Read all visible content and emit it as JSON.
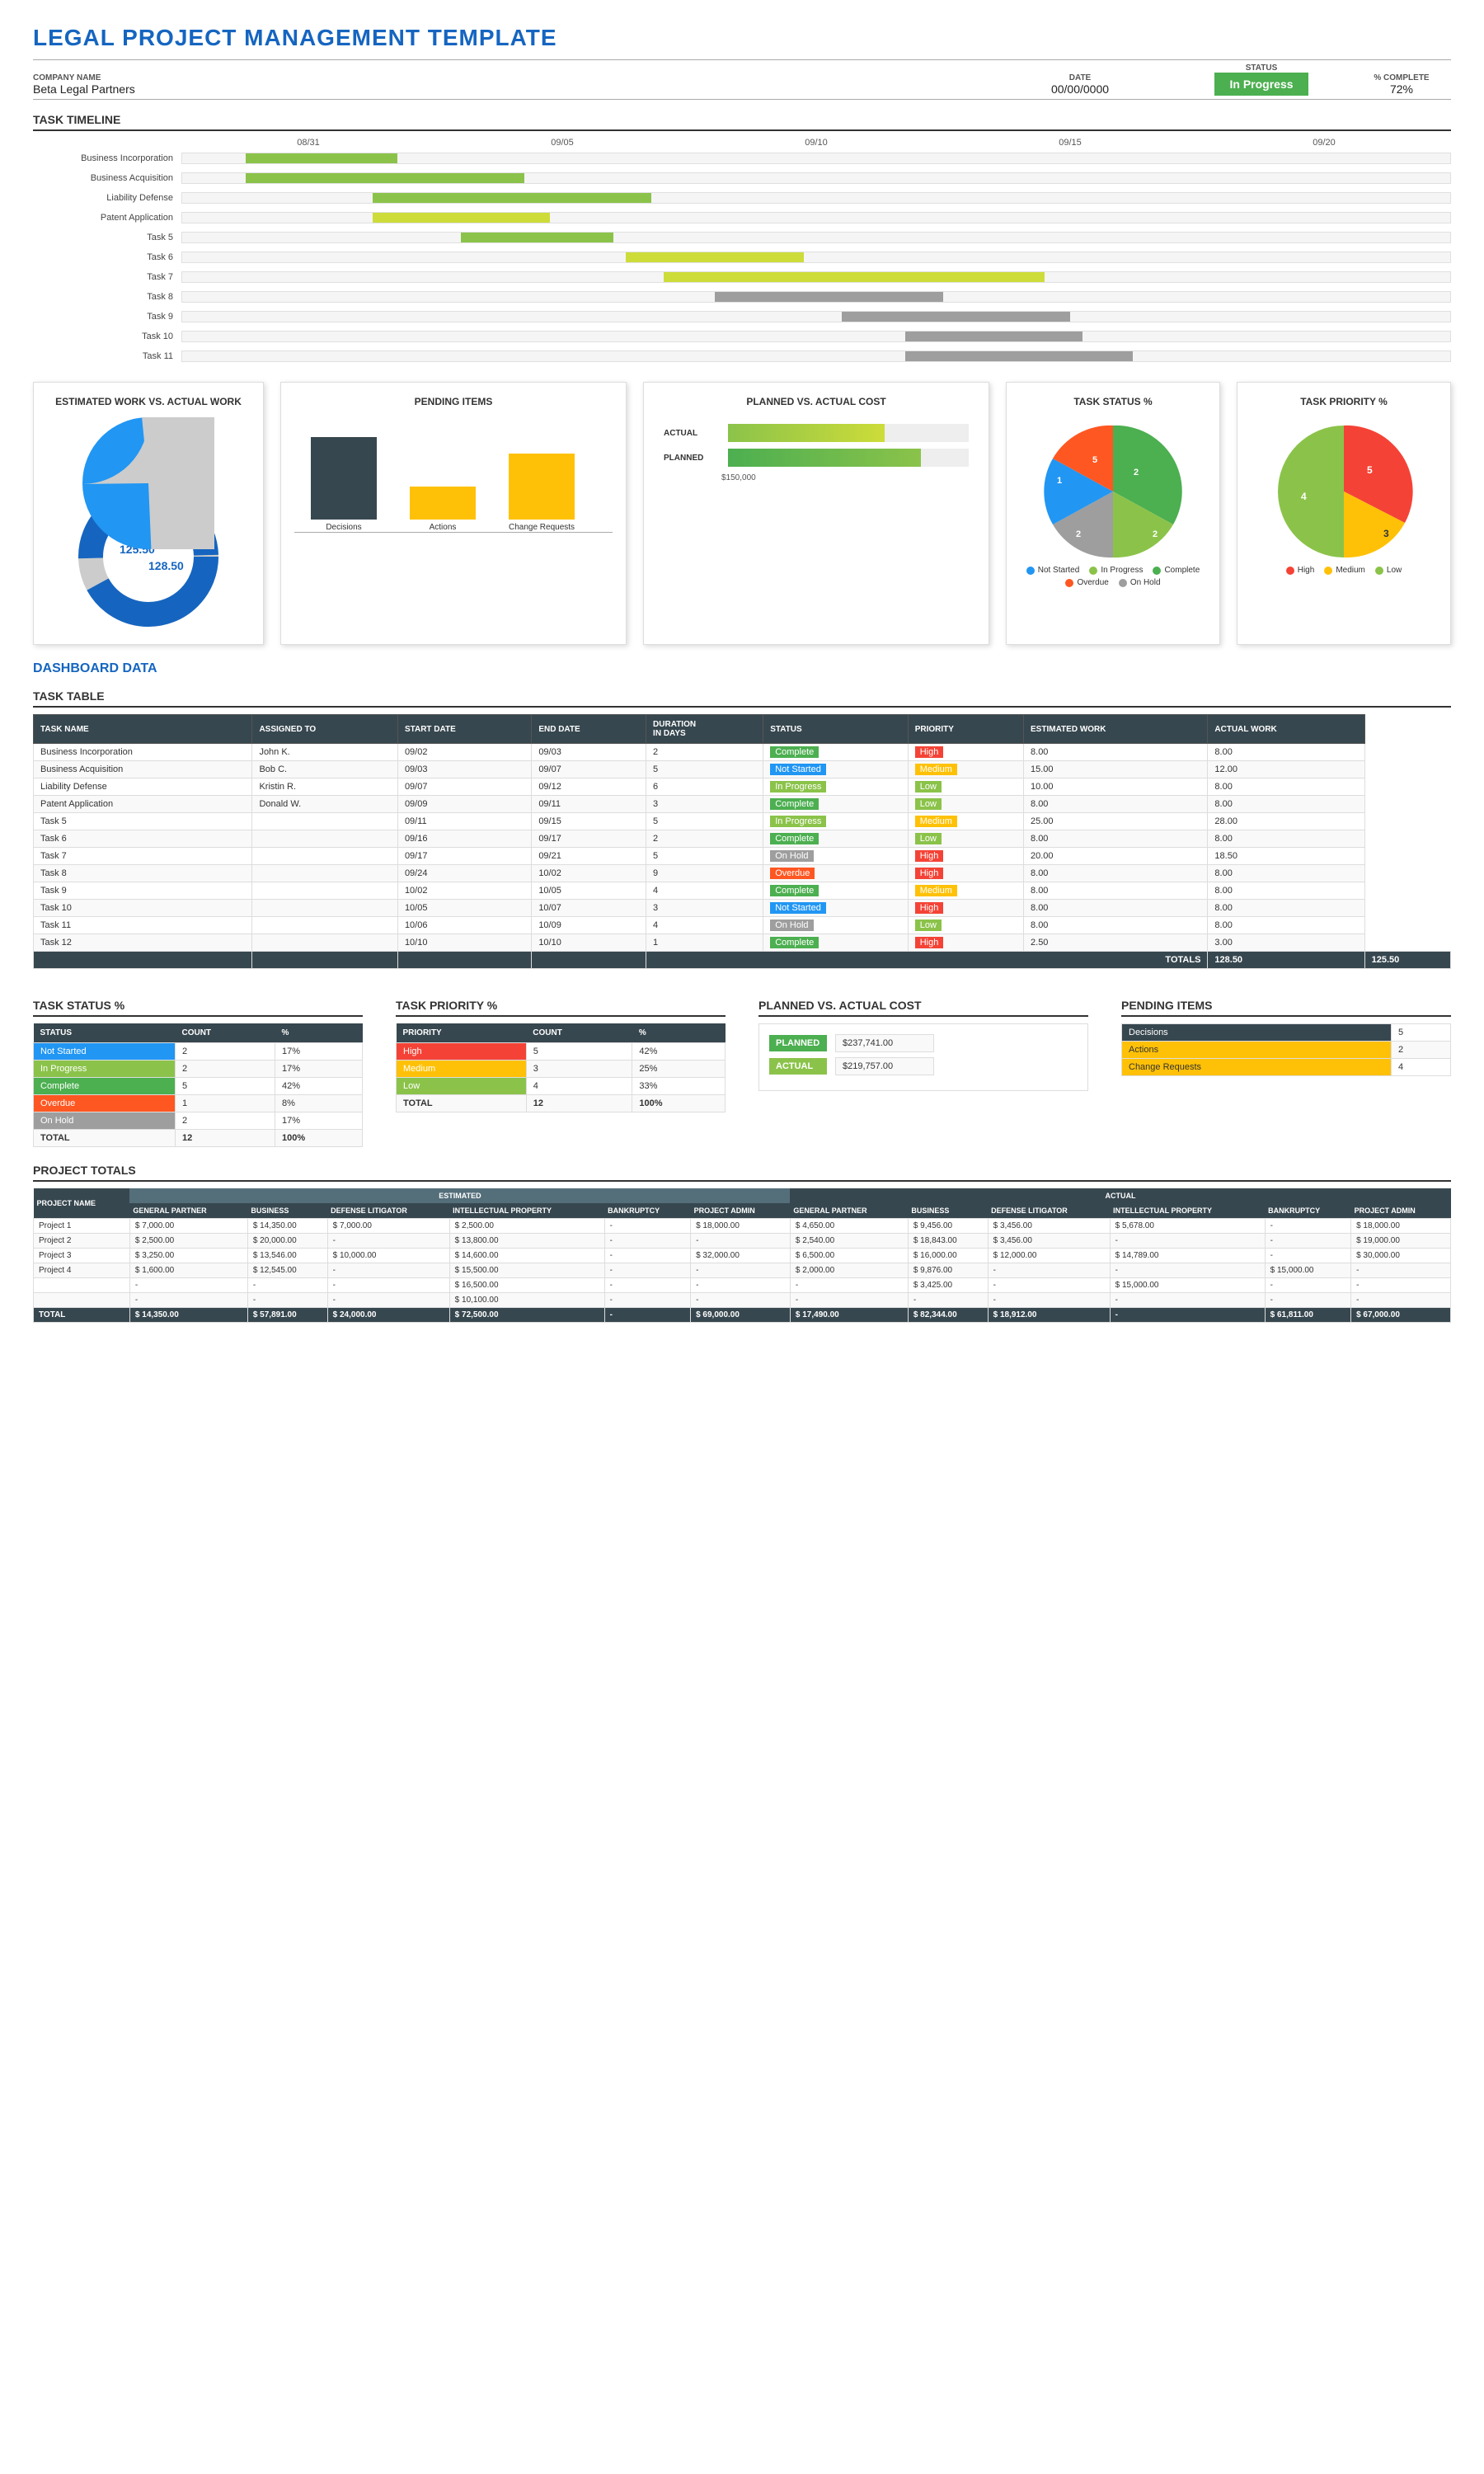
{
  "title": "LEGAL PROJECT MANAGEMENT TEMPLATE",
  "header": {
    "company_label": "COMPANY NAME",
    "company_value": "Beta Legal Partners",
    "date_label": "DATE",
    "date_value": "00/00/0000",
    "status_label": "STATUS",
    "status_value": "In Progress",
    "complete_label": "% COMPLETE",
    "complete_value": "72%"
  },
  "gantt": {
    "title": "TASK TIMELINE",
    "date_labels": [
      "08/31",
      "09/05",
      "09/10",
      "09/15",
      "09/20"
    ],
    "tasks": [
      {
        "name": "Business Incorporation",
        "start": 5,
        "width": 12,
        "color": "green"
      },
      {
        "name": "Business Acquisition",
        "start": 5,
        "width": 22,
        "color": "green"
      },
      {
        "name": "Liability Defense",
        "start": 15,
        "width": 22,
        "color": "green"
      },
      {
        "name": "Patent Application",
        "start": 15,
        "width": 14,
        "color": "lightgreen"
      },
      {
        "name": "Task 5",
        "start": 22,
        "width": 12,
        "color": "green"
      },
      {
        "name": "Task 6",
        "start": 35,
        "width": 14,
        "color": "lightgreen"
      },
      {
        "name": "Task 7",
        "start": 38,
        "width": 30,
        "color": "lightgreen"
      },
      {
        "name": "Task 8",
        "start": 42,
        "width": 18,
        "color": "gray"
      },
      {
        "name": "Task 9",
        "start": 52,
        "width": 18,
        "color": "gray"
      },
      {
        "name": "Task 10",
        "start": 57,
        "width": 14,
        "color": "gray"
      },
      {
        "name": "Task 11",
        "start": 57,
        "width": 18,
        "color": "gray"
      }
    ]
  },
  "estimated_vs_actual": {
    "title": "ESTIMATED WORK VS. ACTUAL WORK",
    "estimated_value": "125.50",
    "actual_value": "128.50"
  },
  "pending_items_chart": {
    "title": "PENDING ITEMS",
    "items": [
      {
        "label": "Decisions",
        "value": 5,
        "color": "#37474F",
        "height": 100
      },
      {
        "label": "Actions",
        "value": 2,
        "color": "#FFC107",
        "height": 40
      },
      {
        "label": "Change Requests",
        "value": 4,
        "color": "#FFC107",
        "height": 80
      }
    ]
  },
  "planned_vs_actual_cost_chart": {
    "title": "PLANNED VS. ACTUAL COST",
    "planned_label": "PLANNED",
    "planned_value": "$237,741.00",
    "planned_width": 80,
    "actual_label": "ACTUAL",
    "actual_value": "$219,757.00",
    "actual_width": 65,
    "axis_label": "$150,000"
  },
  "task_status_pie": {
    "title": "TASK STATUS %",
    "segments": [
      {
        "label": "Not Started",
        "color": "#2196F3",
        "value": 2,
        "pct": 17
      },
      {
        "label": "In Progress",
        "color": "#8BC34A",
        "value": 2,
        "pct": 17
      },
      {
        "label": "Complete",
        "color": "#4CAF50",
        "value": 5,
        "pct": 42
      },
      {
        "label": "Overdue",
        "color": "#FF5722",
        "value": 1,
        "pct": 8
      },
      {
        "label": "On Hold",
        "color": "#9E9E9E",
        "value": 2,
        "pct": 17
      }
    ],
    "labels_on_chart": [
      "1",
      "2",
      "2",
      "2",
      "5"
    ]
  },
  "task_priority_pie": {
    "title": "TASK PRIORITY %",
    "segments": [
      {
        "label": "High",
        "color": "#F44336",
        "value": 5,
        "pct": 42
      },
      {
        "label": "Medium",
        "color": "#FFC107",
        "value": 3,
        "pct": 25
      },
      {
        "label": "Low",
        "color": "#8BC34A",
        "value": 4,
        "pct": 33
      }
    ],
    "labels_on_chart": [
      "3",
      "4",
      "5"
    ]
  },
  "task_table": {
    "title": "TASK TABLE",
    "columns": [
      "TASK NAME",
      "ASSIGNED TO",
      "START DATE",
      "END DATE",
      "DURATION (in days)",
      "STATUS",
      "PRIORITY",
      "ESTIMATED WORK",
      "ACTUAL WORK"
    ],
    "rows": [
      {
        "name": "Business Incorporation",
        "assigned": "John K.",
        "start": "09/02",
        "end": "09/03",
        "duration": 2,
        "status": "Complete",
        "priority": "High",
        "est_work": 8.0,
        "act_work": 8.0
      },
      {
        "name": "Business Acquisition",
        "assigned": "Bob C.",
        "start": "09/03",
        "end": "09/07",
        "duration": 5,
        "status": "Not Started",
        "priority": "Medium",
        "est_work": 15.0,
        "act_work": 12.0
      },
      {
        "name": "Liability Defense",
        "assigned": "Kristin R.",
        "start": "09/07",
        "end": "09/12",
        "duration": 6,
        "status": "In Progress",
        "priority": "Low",
        "est_work": 10.0,
        "act_work": 8.0
      },
      {
        "name": "Patent Application",
        "assigned": "Donald W.",
        "start": "09/09",
        "end": "09/11",
        "duration": 3,
        "status": "Complete",
        "priority": "Low",
        "est_work": 8.0,
        "act_work": 8.0
      },
      {
        "name": "Task 5",
        "assigned": "",
        "start": "09/11",
        "end": "09/15",
        "duration": 5,
        "status": "In Progress",
        "priority": "Medium",
        "est_work": 25.0,
        "act_work": 28.0
      },
      {
        "name": "Task 6",
        "assigned": "",
        "start": "09/16",
        "end": "09/17",
        "duration": 2,
        "status": "Complete",
        "priority": "Low",
        "est_work": 8.0,
        "act_work": 8.0
      },
      {
        "name": "Task 7",
        "assigned": "",
        "start": "09/17",
        "end": "09/21",
        "duration": 5,
        "status": "On Hold",
        "priority": "High",
        "est_work": 20.0,
        "act_work": 18.5
      },
      {
        "name": "Task 8",
        "assigned": "",
        "start": "09/24",
        "end": "10/02",
        "duration": 9,
        "status": "Overdue",
        "priority": "High",
        "est_work": 8.0,
        "act_work": 8.0
      },
      {
        "name": "Task 9",
        "assigned": "",
        "start": "10/02",
        "end": "10/05",
        "duration": 4,
        "status": "Complete",
        "priority": "Medium",
        "est_work": 8.0,
        "act_work": 8.0
      },
      {
        "name": "Task 10",
        "assigned": "",
        "start": "10/05",
        "end": "10/07",
        "duration": 3,
        "status": "Not Started",
        "priority": "High",
        "est_work": 8.0,
        "act_work": 8.0
      },
      {
        "name": "Task 11",
        "assigned": "",
        "start": "10/06",
        "end": "10/09",
        "duration": 4,
        "status": "On Hold",
        "priority": "Low",
        "est_work": 8.0,
        "act_work": 8.0
      },
      {
        "name": "Task 12",
        "assigned": "",
        "start": "10/10",
        "end": "10/10",
        "duration": 1,
        "status": "Complete",
        "priority": "High",
        "est_work": 2.5,
        "act_work": 3.0
      }
    ],
    "totals_label": "TOTALS",
    "totals_est": "128.50",
    "totals_act": "125.50"
  },
  "task_status_table": {
    "title": "TASK STATUS %",
    "columns": [
      "STATUS",
      "COUNT",
      "%"
    ],
    "rows": [
      {
        "status": "Not Started",
        "count": 2,
        "pct": "17%",
        "color_class": "stats-status-ns"
      },
      {
        "status": "In Progress",
        "count": 2,
        "pct": "17%",
        "color_class": "stats-status-ip"
      },
      {
        "status": "Complete",
        "count": 5,
        "pct": "42%",
        "color_class": "stats-status-co"
      },
      {
        "status": "Overdue",
        "count": 1,
        "pct": "8%",
        "color_class": "stats-status-ov"
      },
      {
        "status": "On Hold",
        "count": 2,
        "pct": "17%",
        "color_class": "stats-status-oh"
      }
    ],
    "total_label": "TOTAL",
    "total_count": 12,
    "total_pct": "100%"
  },
  "task_priority_table": {
    "title": "TASK PRIORITY %",
    "columns": [
      "PRIORITY",
      "COUNT",
      "%"
    ],
    "rows": [
      {
        "priority": "High",
        "count": 5,
        "pct": "42%",
        "color_class": "stats-priority-high"
      },
      {
        "priority": "Medium",
        "count": 3,
        "pct": "25%",
        "color_class": "stats-priority-med"
      },
      {
        "priority": "Low",
        "count": 4,
        "pct": "33%",
        "color_class": "stats-priority-low"
      }
    ],
    "total_label": "TOTAL",
    "total_count": 12,
    "total_pct": "100%"
  },
  "planned_actual_cost": {
    "title": "PLANNED VS. ACTUAL COST",
    "planned_label": "PLANNED",
    "planned_value": "$237,741.00",
    "actual_label": "ACTUAL",
    "actual_value": "$219,757.00"
  },
  "pending_items_table": {
    "title": "PENDING ITEMS",
    "columns": [
      "",
      ""
    ],
    "rows": [
      {
        "label": "Decisions",
        "value": 5,
        "color_class": "decisions"
      },
      {
        "label": "Actions",
        "value": 2,
        "color_class": "actions"
      },
      {
        "label": "Change Requests",
        "value": 4,
        "color_class": "change-req"
      }
    ]
  },
  "project_totals": {
    "title": "PROJECT TOTALS",
    "estimated_header": "ESTIMATED",
    "actual_header": "ACTUAL",
    "columns_estimated": [
      "GENERAL PARTNER",
      "BUSINESS",
      "DEFENSE LITIGATOR",
      "INTELLECTUAL PROPERTY",
      "BANKRUPTCY",
      "PROJECT ADMIN"
    ],
    "columns_actual": [
      "GENERAL PARTNER",
      "BUSINESS",
      "DEFENSE LITIGATOR",
      "INTELLECTUAL PROPERTY",
      "BANKRUPTCY",
      "PROJECT ADMIN"
    ],
    "rows": [
      {
        "name": "Project 1",
        "est": [
          "7,000.00",
          "14,350.00",
          "7,000.00",
          "2,500.00",
          "-",
          "18,000.00"
        ],
        "act": [
          "4,650.00",
          "9,456.00",
          "3,456.00",
          "5,678.00",
          "-",
          "18,000.00"
        ]
      },
      {
        "name": "Project 2",
        "est": [
          "2,500.00",
          "20,000.00",
          "-",
          "13,800.00",
          "-",
          "-"
        ],
        "act": [
          "2,540.00",
          "18,843.00",
          "3,456.00",
          "-",
          "-",
          "19,000.00"
        ]
      },
      {
        "name": "Project 3",
        "est": [
          "3,250.00",
          "13,546.00",
          "10,000.00",
          "14,600.00",
          "-",
          "32,000.00"
        ],
        "act": [
          "6,500.00",
          "16,000.00",
          "12,000.00",
          "14,789.00",
          "-",
          "30,000.00"
        ]
      },
      {
        "name": "Project 4",
        "est": [
          "1,600.00",
          "12,545.00",
          "-",
          "15,500.00",
          "-",
          "-"
        ],
        "act": [
          "2,000.00",
          "9,876.00",
          "-",
          "-",
          "15,000.00",
          "-"
        ]
      },
      {
        "name": "",
        "est": [
          "-",
          "-",
          "-",
          "16,500.00",
          "-",
          "-"
        ],
        "act": [
          "-",
          "3,425.00",
          "-",
          "15,000.00",
          "-",
          "-"
        ]
      },
      {
        "name": "",
        "est": [
          "-",
          "-",
          "-",
          "10,100.00",
          "-",
          "-"
        ],
        "act": [
          "-",
          "-",
          "-",
          "-",
          "-",
          "-"
        ]
      }
    ],
    "totals_label": "TOTAL",
    "totals_est": [
      "14,350.00",
      "57,891.00",
      "24,000.00",
      "72,500.00",
      "-",
      "69,000.00"
    ],
    "totals_act": [
      "17,490.00",
      "82,344.00",
      "18,912.00",
      "-",
      "61,811.00",
      "67,000.00"
    ]
  }
}
